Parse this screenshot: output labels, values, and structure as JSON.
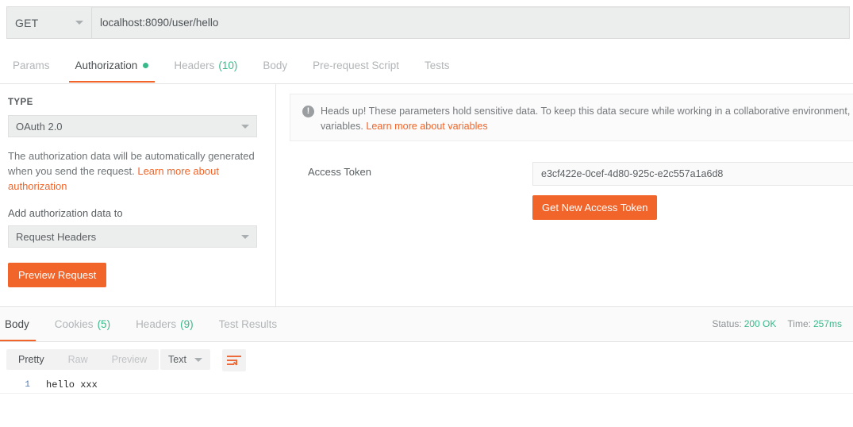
{
  "request_bar": {
    "method": "GET",
    "method_caret": "chevron-down-icon",
    "url": "localhost:8090/user/hello"
  },
  "request_tabs": [
    {
      "label": "Params",
      "active": false,
      "count": "",
      "dot": false
    },
    {
      "label": "Authorization",
      "active": true,
      "count": "",
      "dot": true
    },
    {
      "label": "Headers",
      "active": false,
      "count": "(10)",
      "dot": false
    },
    {
      "label": "Body",
      "active": false,
      "count": "",
      "dot": false
    },
    {
      "label": "Pre-request Script",
      "active": false,
      "count": "",
      "dot": false
    },
    {
      "label": "Tests",
      "active": false,
      "count": "",
      "dot": false
    }
  ],
  "auth_left": {
    "type_label": "TYPE",
    "type_value": "OAuth 2.0",
    "help_text": "The authorization data will be automatically generated when you send the request. ",
    "help_link": "Learn more about authorization",
    "add_to_label": "Add authorization data to",
    "add_to_value": "Request Headers",
    "preview_button": "Preview Request"
  },
  "auth_right": {
    "banner_text": "Heads up! These parameters hold sensitive data. To keep this data secure while working in a collaborative environment, w",
    "banner_text_2": "variables. ",
    "banner_link": "Learn more about variables",
    "access_token_label": "Access Token",
    "access_token_value": "e3cf422e-0cef-4d80-925c-e2c557a1a6d8",
    "get_token_button": "Get New Access Token"
  },
  "response": {
    "tabs": [
      {
        "label": "Body",
        "active": true,
        "count": ""
      },
      {
        "label": "Cookies",
        "active": false,
        "count": "(5)"
      },
      {
        "label": "Headers",
        "active": false,
        "count": "(9)"
      },
      {
        "label": "Test Results",
        "active": false,
        "count": ""
      }
    ],
    "status_label": "Status:",
    "status_value": "200 OK",
    "time_label": "Time:",
    "time_value": "257ms",
    "view_modes": [
      {
        "label": "Pretty",
        "active": true
      },
      {
        "label": "Raw",
        "active": false
      },
      {
        "label": "Preview",
        "active": false
      }
    ],
    "format": "Text",
    "format_caret": "chevron-down-icon",
    "wrap_icon": "wrap-lines-icon",
    "body_lines": [
      {
        "num": "1",
        "text": "hello xxx"
      }
    ]
  },
  "colors": {
    "accent_orange": "#f1652a",
    "status_green": "#39b98a"
  }
}
